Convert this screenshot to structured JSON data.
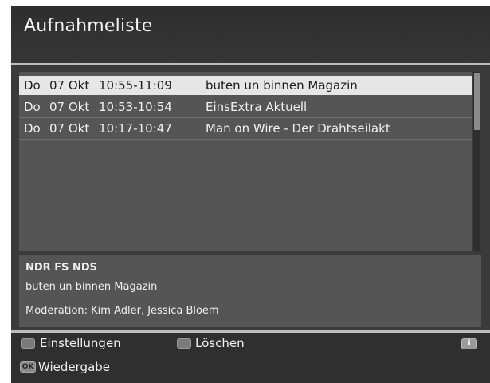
{
  "header": {
    "title": "Aufnahmeliste"
  },
  "recordings": [
    {
      "day": "Do",
      "date": "07 Okt",
      "time": "10:55-11:09",
      "title": "buten un binnen Magazin",
      "selected": true
    },
    {
      "day": "Do",
      "date": "07 Okt",
      "time": "10:53-10:54",
      "title": "EinsExtra Aktuell",
      "selected": false
    },
    {
      "day": "Do",
      "date": "07 Okt",
      "time": "10:17-10:47",
      "title": "Man on Wire - Der Drahtseilakt",
      "selected": false
    }
  ],
  "info": {
    "channel": "NDR FS NDS",
    "title": "buten un binnen Magazin",
    "description": "Moderation: Kim Adler, Jessica Bloem"
  },
  "footer": {
    "settings_label": "Einstellungen",
    "delete_label": "Löschen",
    "play_label": "Wiedergabe",
    "ok_key_label": "OK",
    "info_key_label": "i"
  }
}
